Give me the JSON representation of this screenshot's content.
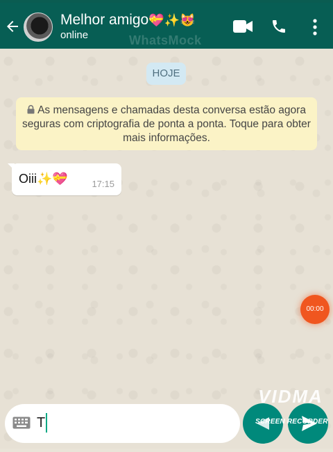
{
  "header": {
    "contact_name": "Melhor amigo",
    "name_emojis": "💝✨😻",
    "status": "online",
    "watermark": "WhatsMock"
  },
  "icons": {
    "back": "arrow-left-icon",
    "video": "video-call-icon",
    "voice": "phone-icon",
    "menu": "more-vertical-icon",
    "lock": "lock-icon",
    "keyboard": "keyboard-icon",
    "send": "send-icon"
  },
  "chat": {
    "date_chip": "HOJE",
    "encryption_notice": "As mensagens e chamadas desta conversa estão agora seguras com criptografia de ponta a ponta. Toque para obter mais informações.",
    "messages": [
      {
        "text": "Oiii",
        "emojis": "✨💝",
        "time": "17:15",
        "direction": "incoming"
      }
    ]
  },
  "recorder": {
    "timer": "00:00",
    "brand": "VIDMA",
    "brand_sub": "SCREEN RECORDER"
  },
  "composer": {
    "value": "T"
  },
  "colors": {
    "header_bg": "#075e54",
    "accent": "#00897b",
    "notice_bg": "#fbf3c6",
    "date_chip_bg": "#d3e9f3",
    "recorder_badge": "#f0561f"
  }
}
